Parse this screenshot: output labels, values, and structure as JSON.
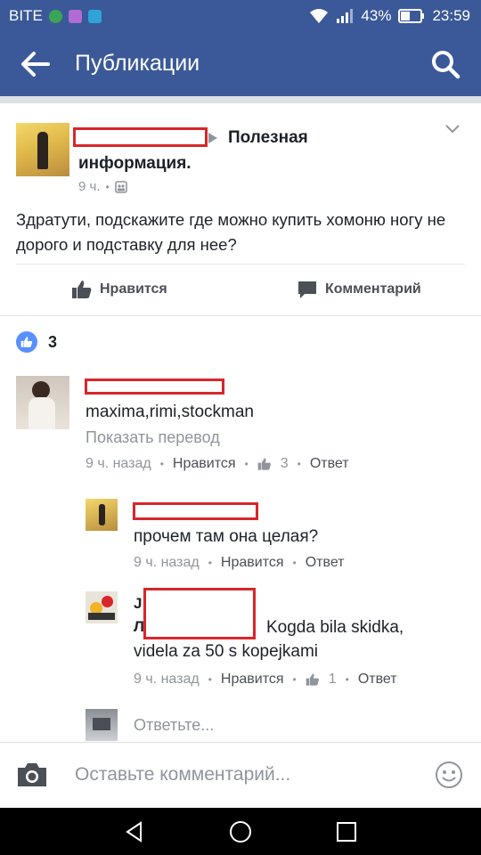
{
  "status_bar": {
    "carrier": "BITE",
    "battery": "43%",
    "time": "23:59"
  },
  "app_bar": {
    "title": "Публикации"
  },
  "post": {
    "header_part1": "Полезная",
    "header_part2": "информация.",
    "time": "9 ч.",
    "text": "Здратути, подскажите где можно купить хомоню ногу не дорого и подставку для нее?",
    "like_action": "Нравится",
    "comment_action": "Комментарий",
    "reactions_count": "3"
  },
  "comments": [
    {
      "text": "maxima,rimi,stockman",
      "translate": "Показать перевод",
      "time": "9 ч. назад",
      "like": "Нравится",
      "likes": "3",
      "reply": "Ответ"
    },
    {
      "text": "прочем там она целая?",
      "time": "9 ч. назад",
      "like": "Нравится",
      "reply": "Ответ"
    },
    {
      "name_fragment1": "J",
      "name_fragment2": "Л",
      "text_line1": "Kogda bila skidka,",
      "text_line2": "videla za 50 s kopejkami",
      "time": "9 ч. назад",
      "like": "Нравится",
      "likes": "1",
      "reply": "Ответ"
    }
  ],
  "reply_placeholder": "Ответьте...",
  "composer": {
    "placeholder": "Оставьте комментарий..."
  },
  "colors": {
    "brand": "#3b5998",
    "redaction": "#d9262a",
    "like_blue": "#5890ff"
  }
}
